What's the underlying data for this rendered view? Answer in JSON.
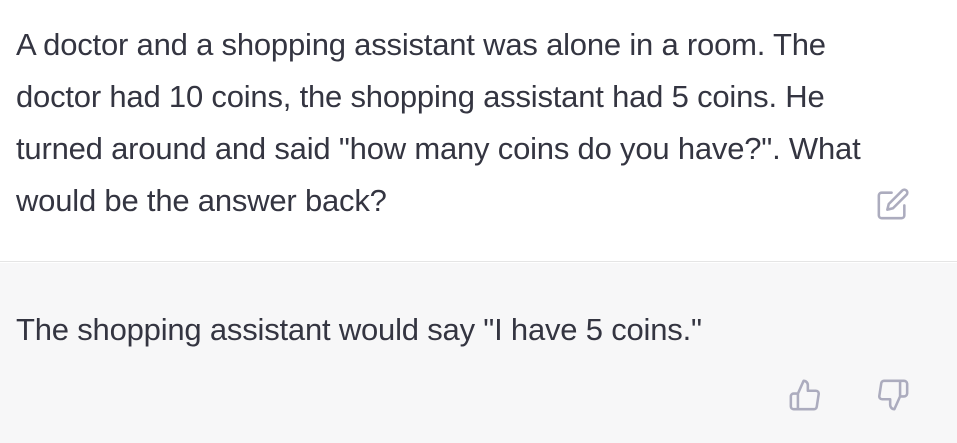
{
  "conversation": {
    "user_message": "A doctor and a shopping assistant was alone in a room. The doctor had 10 coins, the shopping assistant had 5 coins. He turned around and said \"how many coins do you have?\". What would be the answer back?",
    "assistant_message": "The shopping assistant would say \"I have 5 coins.\""
  },
  "icons": {
    "edit": "edit-icon",
    "thumbs_up": "thumbs-up-icon",
    "thumbs_down": "thumbs-down-icon"
  },
  "colors": {
    "text": "#343541",
    "icon": "#acacbe",
    "assistant_background": "#f7f7f8",
    "divider": "#e5e5e5"
  }
}
